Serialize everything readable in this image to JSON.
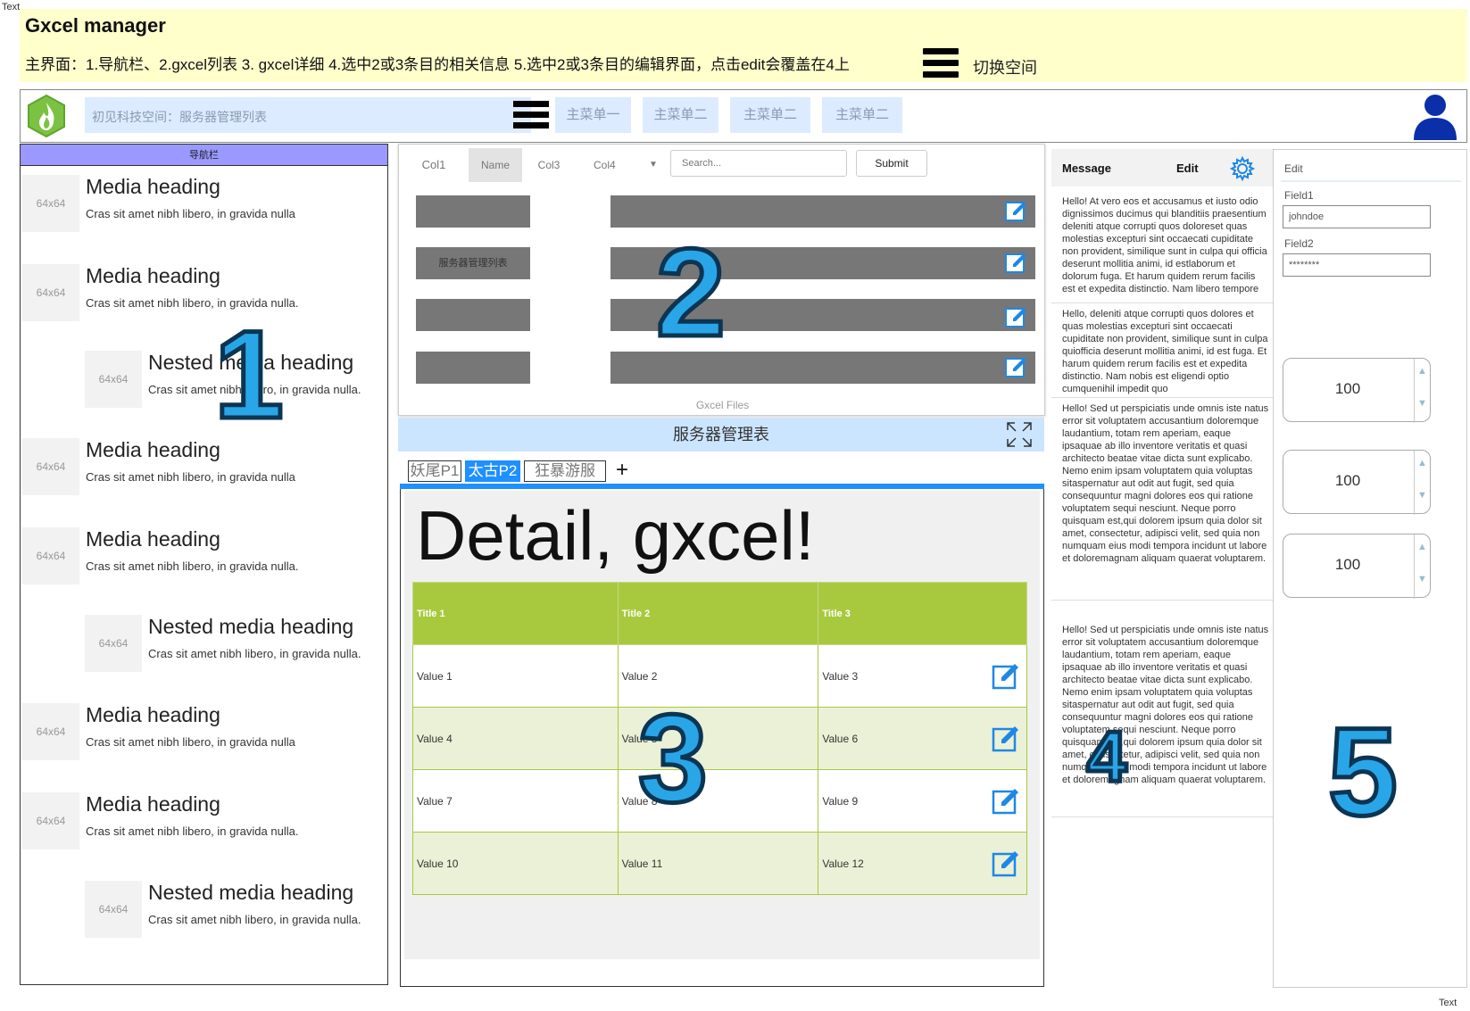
{
  "corner_labels": {
    "top_left": "Text",
    "bottom_right": "Text"
  },
  "banner": {
    "title": "Gxcel manager",
    "description": "主界面：1.导航栏、2.gxcel列表 3. gxcel详细 4.选中2或3条目的相关信息 5.选中2或3条目的编辑界面，点击edit会覆盖在4上",
    "switch_label": "切换空间",
    "switch_icon": "hamburger-icon"
  },
  "topnav": {
    "logo_icon": "flame-logo-icon",
    "space_text": "初见科技空间：服务器管理列表",
    "menu_icon": "hamburger-icon",
    "menus": [
      "主菜单一",
      "主菜单二",
      "主菜单二",
      "主菜单二"
    ],
    "avatar_icon": "user-avatar-icon"
  },
  "leftnav": {
    "header": "导航栏",
    "thumb_label": "64x64",
    "items": [
      {
        "heading": "Media heading",
        "text": "Cras sit amet nibh libero, in gravida nulla",
        "nested": false
      },
      {
        "heading": "Media heading",
        "text": "Cras sit amet nibh libero, in gravida nulla.",
        "nested": false
      },
      {
        "heading": "Nested media heading",
        "text": "Cras sit amet nibh libero, in gravida nulla.",
        "nested": true
      },
      {
        "heading": "Media heading",
        "text": "Cras sit amet nibh libero, in gravida nulla",
        "nested": false
      },
      {
        "heading": "Media heading",
        "text": "Cras sit amet nibh libero, in gravida nulla.",
        "nested": false
      },
      {
        "heading": "Nested media heading",
        "text": "Cras sit amet nibh libero, in gravida nulla.",
        "nested": true
      },
      {
        "heading": "Media heading",
        "text": "Cras sit amet nibh libero, in gravida nulla",
        "nested": false
      },
      {
        "heading": "Media heading",
        "text": "Cras sit amet nibh libero, in gravida nulla.",
        "nested": false
      },
      {
        "heading": "Nested media heading",
        "text": "Cras sit amet nibh libero, in gravida nulla.",
        "nested": true
      }
    ]
  },
  "list_panel": {
    "columns": [
      "Col1",
      "Name",
      "Col3",
      "Col4"
    ],
    "search_placeholder": "Search...",
    "submit_label": "Submit",
    "rows": [
      {
        "label": ""
      },
      {
        "label": "服务器管理列表"
      },
      {
        "label": ""
      },
      {
        "label": ""
      }
    ],
    "footer": "Gxcel Files",
    "title_bar": "服务器管理表",
    "expand_icon": "expand-icon"
  },
  "tabs": {
    "items": [
      "妖尾P1",
      "太古P2",
      "狂暴游服"
    ],
    "active_index": 1,
    "add_label": "+"
  },
  "detail": {
    "title": "Detail, gxcel!",
    "headers": [
      "Title 1",
      "Title 2",
      "Title 3"
    ],
    "rows": [
      [
        "Value 1",
        "Value 2",
        "Value 3"
      ],
      [
        "Value 4",
        "Value 5",
        "Value 6"
      ],
      [
        "Value 7",
        "Value 8",
        "Value 9"
      ],
      [
        "Value 10",
        "Value 11",
        "Value 12"
      ]
    ]
  },
  "messages": {
    "title": "Message",
    "edit_label": "Edit",
    "gear_icon": "gear-icon",
    "items": [
      "Hello! At vero eos et accusamus et iusto odio dignissimos ducimus qui blanditiis praesentium deleniti atque corrupti quos doloreset quas molestias excepturi sint occaecati cupiditate non provident, similique sunt in culpa qui officia deserunt mollitia animi, id estlaborum et dolorum fuga. Et harum quidem rerum facilis est et expedita distinctio. Nam libero tempore",
      "Hello, deleniti atque corrupti quos dolores et quas molestias excepturi sint occaecati cupiditate non provident, similique sunt in culpa quiofficia deserunt mollitia animi, id est fuga. Et harum quidem rerum facilis est et expedita distinctio. Nam nobis est eligendi optio cumquenihil impedit quo",
      "Hello! Sed ut perspiciatis unde omnis iste natus error sit voluptatem accusantium doloremque laudantium, totam rem aperiam, eaque ipsaquae ab illo inventore veritatis et quasi architecto beatae vitae dicta sunt explicabo. Nemo enim ipsam voluptatem quia voluptas sitaspernatur aut odit aut fugit, sed quia consequuntur magni dolores eos qui ratione voluptatem sequi nesciunt. Neque porro quisquam est,qui dolorem ipsum quia dolor sit amet, consectetur, adipisci velit, sed quia non numquam eius modi tempora incidunt ut labore et doloremagnam aliquam quaerat voluptarem.",
      "Hello! Sed ut perspiciatis unde omnis iste natus error sit voluptatem accusantium doloremque laudantium, totam rem aperiam, eaque ipsaquae ab illo inventore veritatis et quasi architecto beatae vitae dicta sunt explicabo. Nemo enim ipsam voluptatem quia voluptas sitaspernatur aut odit aut fugit, sed quia consequuntur magni dolores eos qui ratione voluptatem sequi nesciunt. Neque porro quisquam est,qui dolorem ipsum quia dolor sit amet, consectetur, adipisci velit, sed quia non numquam eius modi tempora incidunt ut labore et doloremagnam aliquam quaerat voluptarem."
    ]
  },
  "edit_panel": {
    "title": "Edit",
    "field1_label": "Field1",
    "field1_value": "johndoe",
    "field2_label": "Field2",
    "field2_value": "********",
    "steppers": [
      "100",
      "100",
      "100"
    ]
  },
  "annotations": [
    "1",
    "2",
    "3",
    "4",
    "5"
  ],
  "colors": {
    "banner_bg": "#ffffcc",
    "nav_header": "#9999ff",
    "table_header": "#a8c93e",
    "tab_active": "#1e90ff",
    "menu_bg": "#dcebff",
    "annotation": "#29a6e8"
  }
}
